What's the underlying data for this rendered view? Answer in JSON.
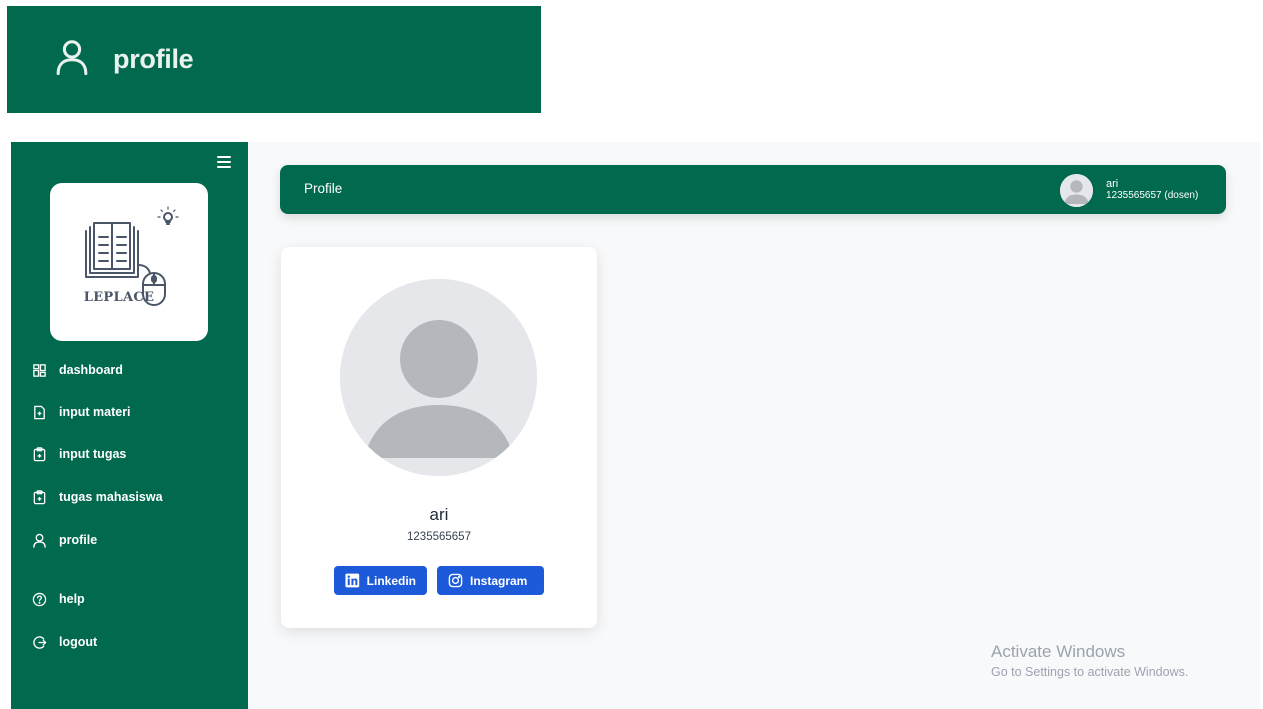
{
  "colors": {
    "brand_green": "#016a4e",
    "button_blue": "#1d5ad9",
    "page_bg": "#f8f9fa"
  },
  "zoom_banner": {
    "icon": "user-icon",
    "label": "profile"
  },
  "sidebar": {
    "logo_text": "LEPLACE",
    "items": [
      {
        "label": "dashboard",
        "icon": "grid-icon"
      },
      {
        "label": "input materi",
        "icon": "file-plus-icon"
      },
      {
        "label": "input tugas",
        "icon": "clipboard-plus-icon"
      },
      {
        "label": "tugas mahasiswa",
        "icon": "clipboard-plus-icon"
      },
      {
        "label": "profile",
        "icon": "user-icon"
      },
      {
        "label": "help",
        "icon": "help-circle-icon"
      },
      {
        "label": "logout",
        "icon": "logout-icon"
      }
    ]
  },
  "topbar": {
    "title": "Profile",
    "user": {
      "name": "ari",
      "subtitle": "1235565657 (dosen)"
    }
  },
  "profile": {
    "name": "ari",
    "id": "1235565657",
    "buttons": {
      "linkedin": "Linkedin",
      "instagram": "Instagram"
    }
  },
  "watermark": {
    "title": "Activate Windows",
    "subtitle": "Go to Settings to activate Windows."
  }
}
